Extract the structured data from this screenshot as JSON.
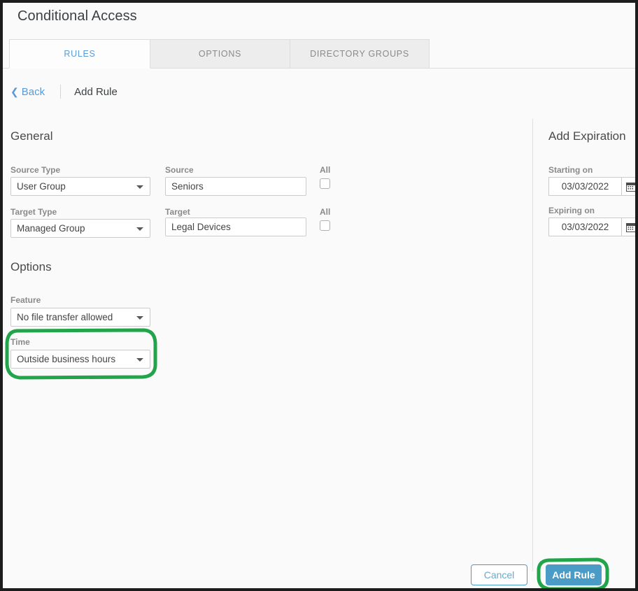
{
  "window": {
    "title": "Conditional Access"
  },
  "tabs": [
    {
      "id": "rules",
      "label": "RULES",
      "active": true
    },
    {
      "id": "options",
      "label": "OPTIONS",
      "active": false
    },
    {
      "id": "directory_groups",
      "label": "DIRECTORY GROUPS",
      "active": false
    }
  ],
  "breadcrumb": {
    "back_label": "Back",
    "back_chevron": "chevron-left-icon",
    "current": "Add Rule"
  },
  "general": {
    "heading": "General",
    "source_type": {
      "label": "Source Type",
      "value": "User Group"
    },
    "source": {
      "label": "Source",
      "value": "Seniors"
    },
    "source_all": {
      "label": "All",
      "checked": false
    },
    "target_type": {
      "label": "Target Type",
      "value": "Managed Group"
    },
    "target": {
      "label": "Target",
      "value": "Legal Devices"
    },
    "target_all": {
      "label": "All",
      "checked": false
    }
  },
  "options": {
    "heading": "Options",
    "feature": {
      "label": "Feature",
      "value": "No file transfer allowed"
    },
    "time": {
      "label": "Time",
      "value": "Outside business hours",
      "highlighted": true
    }
  },
  "expiration": {
    "heading": "Add Expiration",
    "starting_on": {
      "label": "Starting on",
      "value": "03/03/2022",
      "icon": "calendar-icon"
    },
    "expiring_on": {
      "label": "Expiring on",
      "value": "03/03/2022",
      "icon": "calendar-icon"
    }
  },
  "footer": {
    "cancel_label": "Cancel",
    "add_rule_label": "Add Rule",
    "add_rule_highlighted": true
  },
  "colors": {
    "accent_blue": "#4a9cc7",
    "link_blue": "#5b9bd5",
    "annotation_green": "#22a44b",
    "label_gray": "#8a8a8a",
    "window_bg": "#fafafa"
  }
}
